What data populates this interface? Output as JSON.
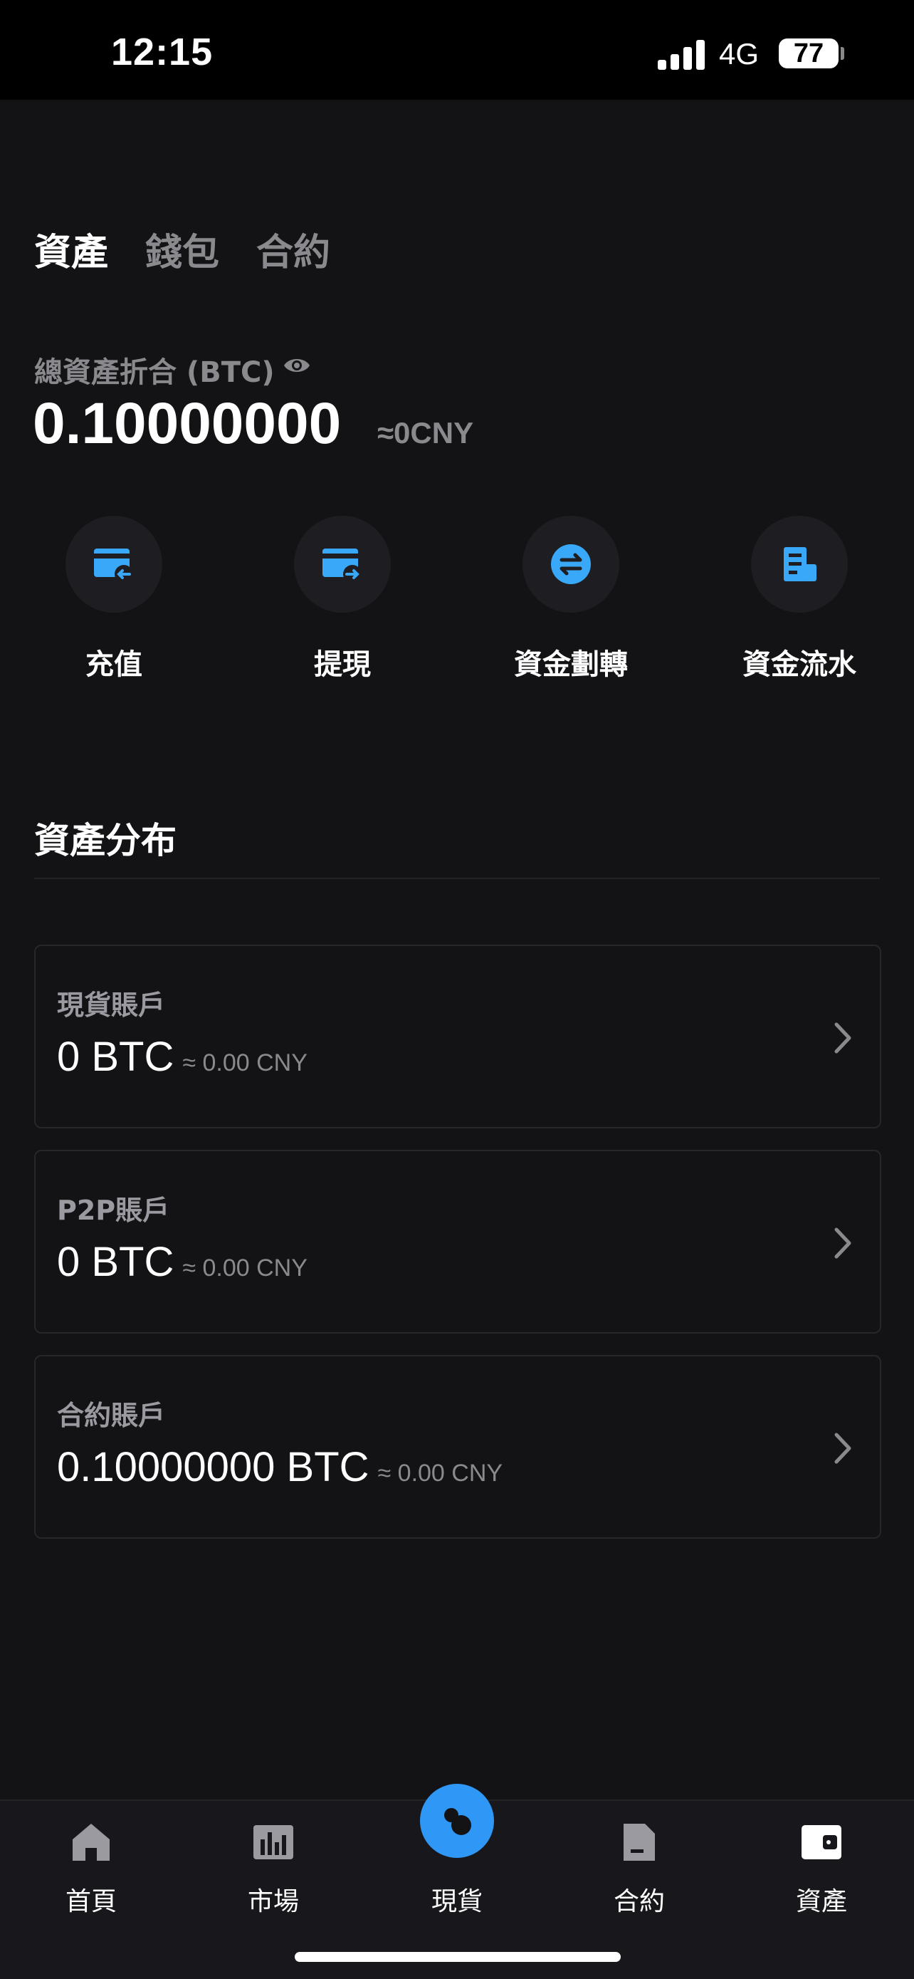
{
  "status_bar": {
    "time": "12:15",
    "network": "4G",
    "battery": "77"
  },
  "top_tabs": [
    {
      "label": "資產",
      "active": true
    },
    {
      "label": "錢包",
      "active": false
    },
    {
      "label": "合約",
      "active": false
    }
  ],
  "total": {
    "label": "總資產折合 (BTC)",
    "value": "0.10000000",
    "approx": "≈0CNY"
  },
  "actions": [
    {
      "label": "充值",
      "icon": "deposit-icon"
    },
    {
      "label": "提現",
      "icon": "withdraw-icon"
    },
    {
      "label": "資金劃轉",
      "icon": "transfer-icon"
    },
    {
      "label": "資金流水",
      "icon": "ledger-icon"
    }
  ],
  "distribution": {
    "title": "資產分布",
    "accounts": [
      {
        "name": "現貨賬戶",
        "amount": "0 BTC",
        "approx": "≈ 0.00 CNY"
      },
      {
        "name": "P2P賬戶",
        "amount": "0 BTC",
        "approx": "≈ 0.00 CNY"
      },
      {
        "name": "合約賬戶",
        "amount": "0.10000000 BTC",
        "approx": "≈ 0.00 CNY"
      }
    ]
  },
  "bottom_nav": [
    {
      "label": "首頁",
      "icon": "home-icon"
    },
    {
      "label": "市場",
      "icon": "market-chart-icon"
    },
    {
      "label": "現貨",
      "icon": "spot-icon"
    },
    {
      "label": "合約",
      "icon": "contract-icon"
    },
    {
      "label": "資產",
      "icon": "wallet-icon"
    }
  ],
  "colors": {
    "background": "#131316",
    "accent": "#2f97f5",
    "muted_text": "#8a8a8e"
  }
}
